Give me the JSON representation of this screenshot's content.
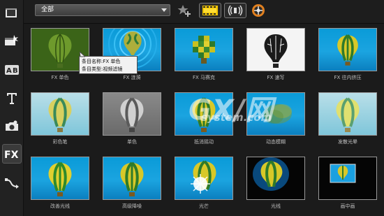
{
  "toolbar": {
    "category_select": "全部",
    "icons": [
      "add-favorite-icon",
      "video-filter-icon",
      "audio-filter-icon",
      "settings-wheel-icon"
    ]
  },
  "sidebar": {
    "items": [
      {
        "icon": "media-icon"
      },
      {
        "icon": "instant-project-icon"
      },
      {
        "icon": "transition-icon"
      },
      {
        "icon": "title-icon"
      },
      {
        "icon": "graphic-icon"
      },
      {
        "icon": "filter-fx-icon",
        "label": "FX",
        "active": true
      },
      {
        "icon": "path-motion-icon"
      }
    ]
  },
  "filters": [
    {
      "label": "FX 单色",
      "style": "green"
    },
    {
      "label": "FX 涟漪",
      "style": "ripple"
    },
    {
      "label": "FX 马赛克",
      "style": "mosaic"
    },
    {
      "label": "FX 速写",
      "style": "sketch"
    },
    {
      "label": "FX 往内挤压",
      "style": "normal"
    },
    {
      "label": "彩色笔",
      "style": "pale"
    },
    {
      "label": "单色",
      "style": "mono"
    },
    {
      "label": "抵消摇动",
      "style": "normal"
    },
    {
      "label": "动态模糊",
      "style": "blur"
    },
    {
      "label": "发散光晕",
      "style": "pale"
    },
    {
      "label": "改善光线",
      "style": "normal"
    },
    {
      "label": "高级降噪",
      "style": "normal"
    },
    {
      "label": "光芒",
      "style": "flare"
    },
    {
      "label": "光线",
      "style": "light"
    },
    {
      "label": "画中画",
      "style": "pip"
    }
  ],
  "tooltip": {
    "line1": "条目名称:FX 单色",
    "line2": "条目类型:视频滤镜"
  },
  "watermark": {
    "big": "GX/网",
    "small": "system.com"
  }
}
